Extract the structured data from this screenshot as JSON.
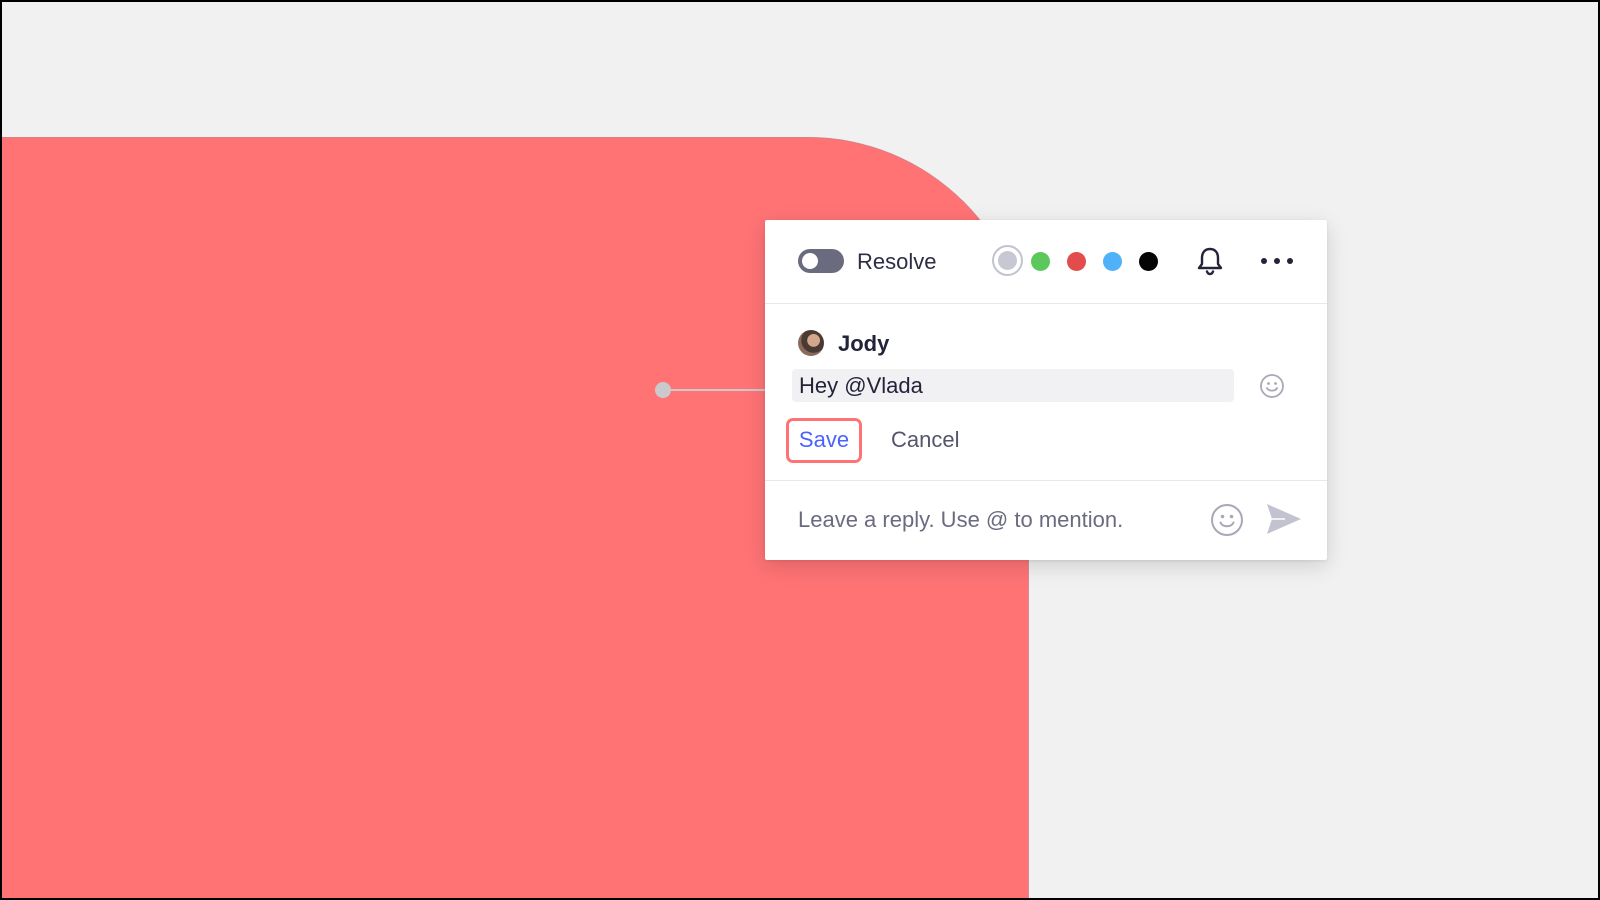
{
  "toolbar": {
    "resolve_label": "Resolve",
    "resolve_on": false,
    "colors": [
      {
        "name": "gray",
        "hex": "#c8c8d4",
        "selected": true
      },
      {
        "name": "green",
        "hex": "#5cc85c",
        "selected": false
      },
      {
        "name": "red",
        "hex": "#e24c4c",
        "selected": false
      },
      {
        "name": "blue",
        "hex": "#4fb1f8",
        "selected": false
      },
      {
        "name": "black",
        "hex": "#050505",
        "selected": false
      }
    ],
    "icons": [
      "bell-icon",
      "more-icon"
    ]
  },
  "comment": {
    "author": "Jody",
    "text": "Hey @Vlada",
    "save_label": "Save",
    "cancel_label": "Cancel"
  },
  "reply": {
    "placeholder": "Leave a reply. Use @ to mention."
  },
  "colors": {
    "canvas_shape": "#ff7375",
    "accent_link": "#4a63ff",
    "save_outline": "#ff7375"
  }
}
